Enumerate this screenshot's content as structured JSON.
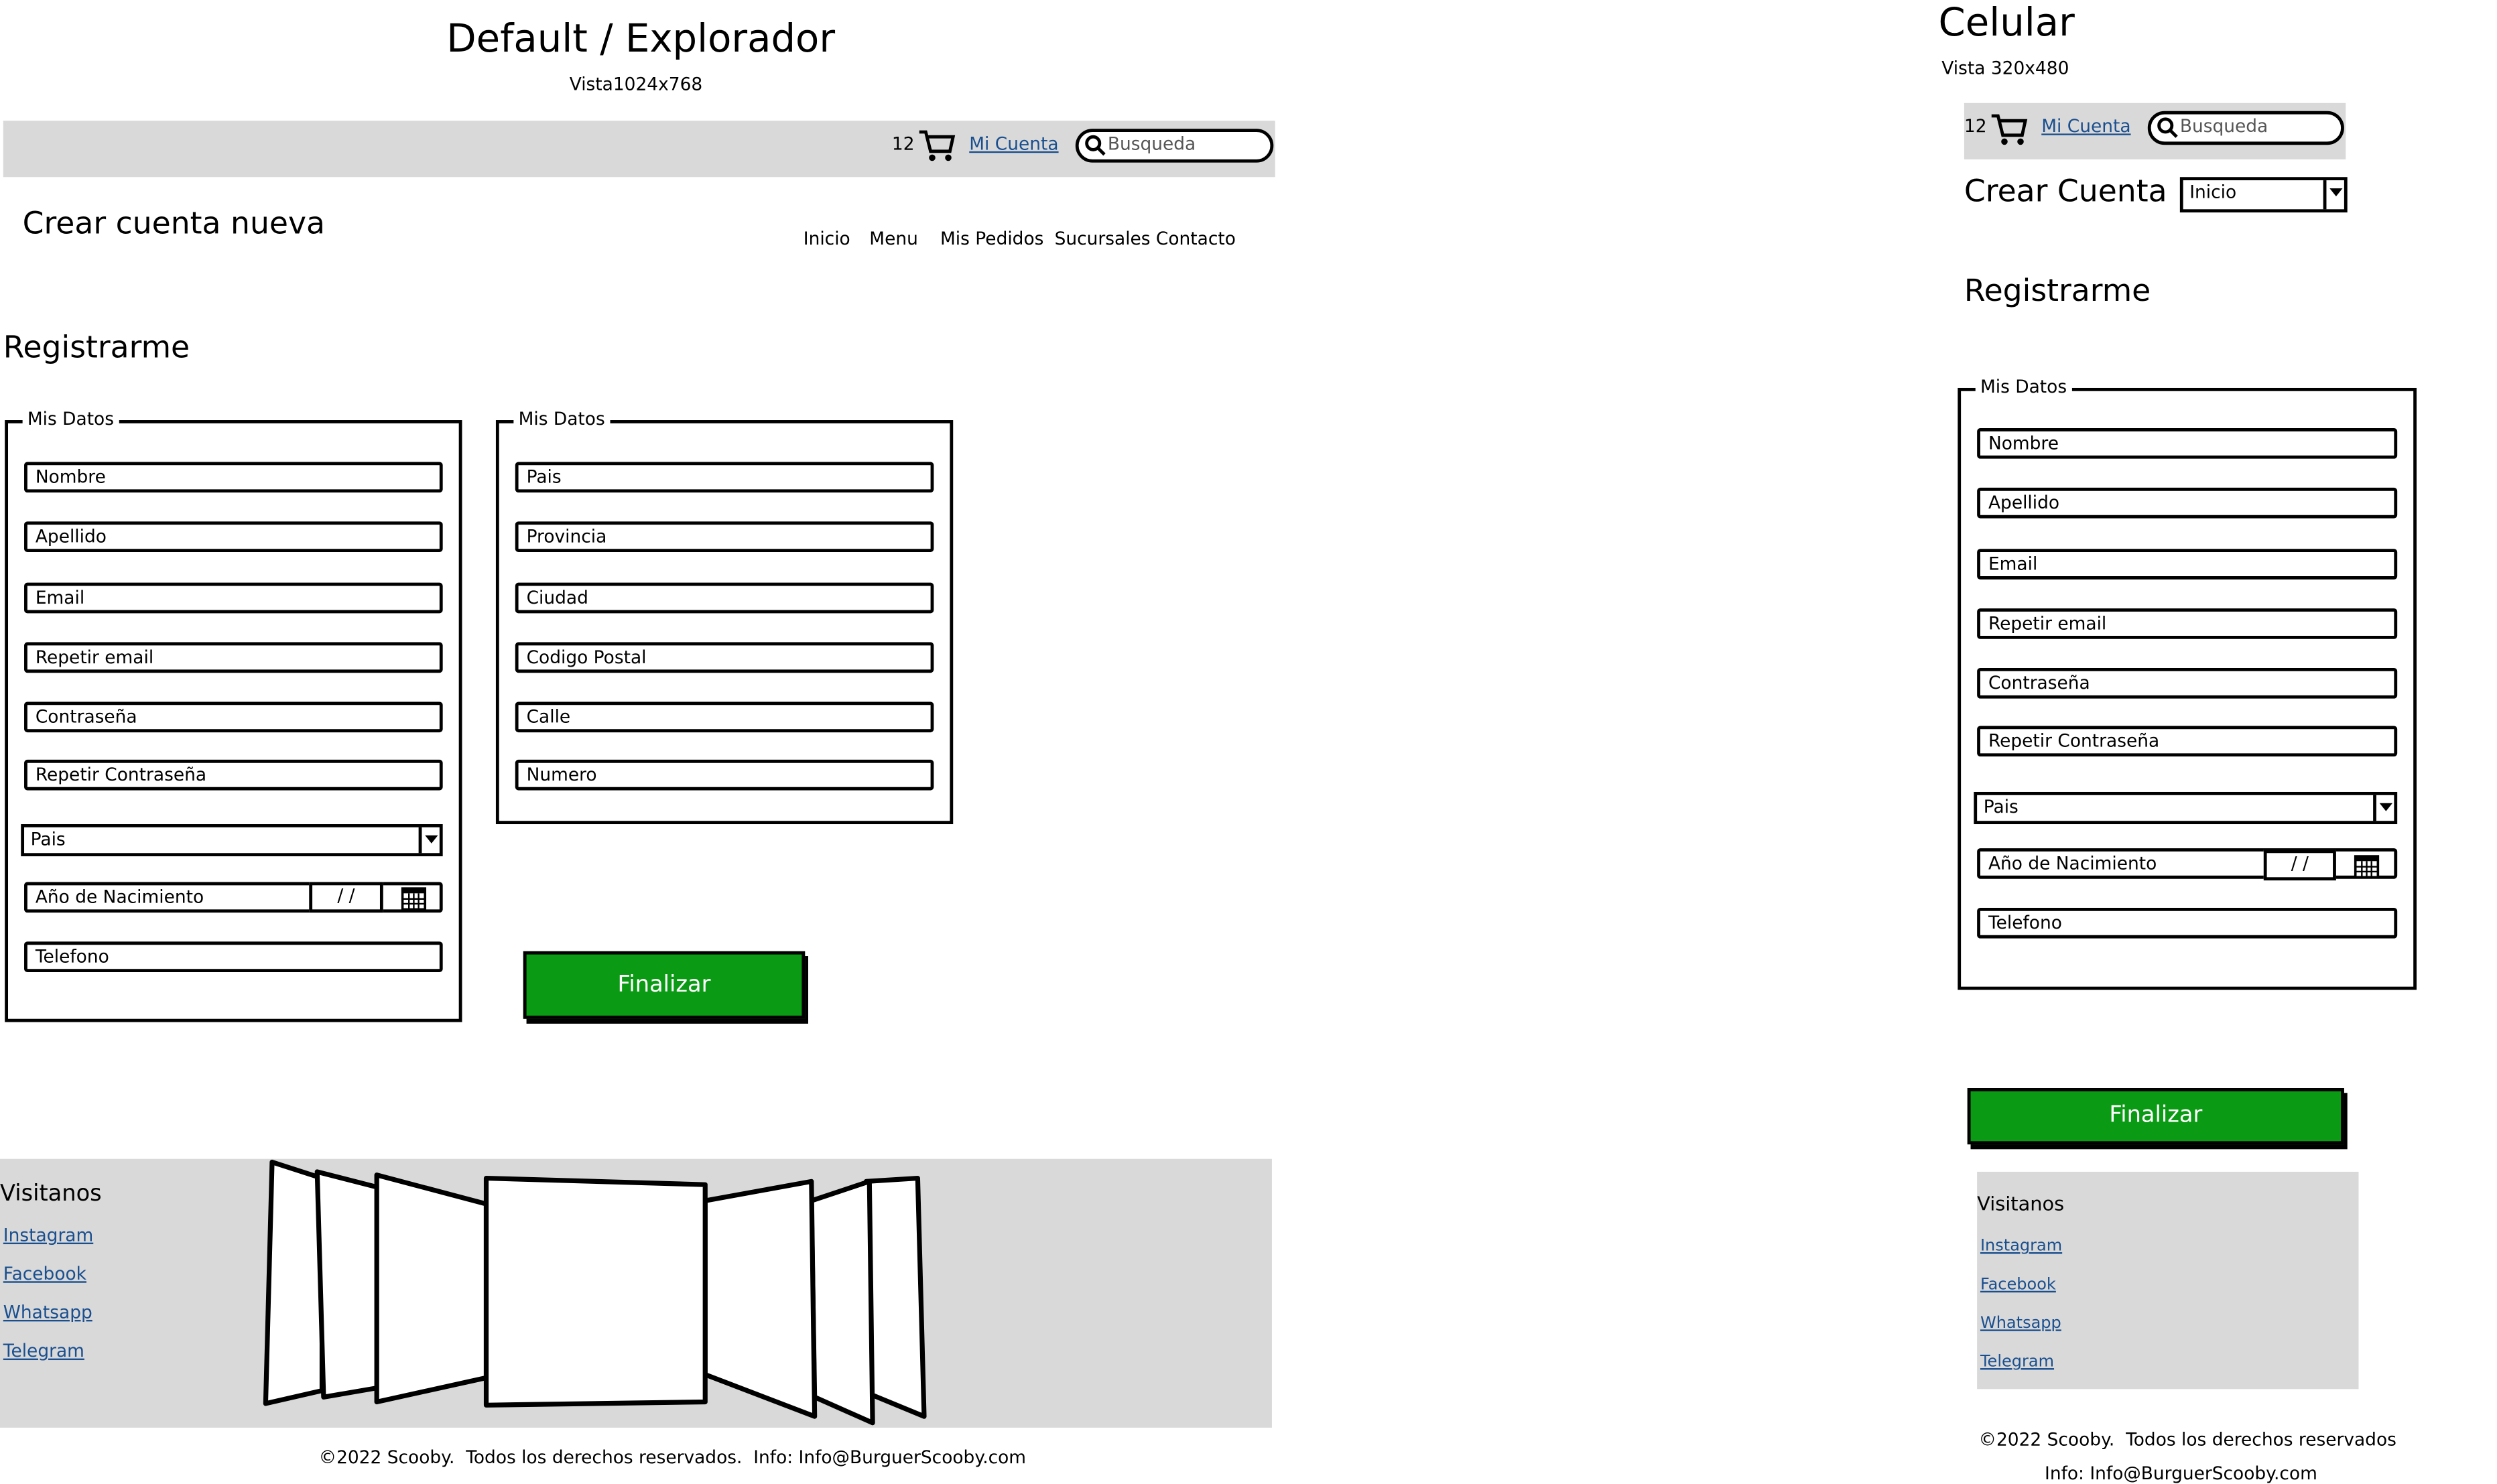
{
  "desktop": {
    "heading": "Default / Explorador",
    "subheading": "Vista1024x768",
    "topbar": {
      "cart_count": "12",
      "account_link": "Mi Cuenta",
      "search_placeholder": "Busqueda"
    },
    "page_title": "Crear cuenta nueva",
    "nav": [
      "Inicio",
      "Menu",
      "Mis Pedidos",
      "Sucursales",
      "Contacto"
    ],
    "section_title": "Registrarme",
    "group1": {
      "legend": "Mis Datos",
      "fields": [
        "Nombre",
        "Apellido",
        "Email",
        "Repetir email",
        "Contraseña",
        "Repetir Contraseña"
      ],
      "country_select": "Pais",
      "birth_label": "Año de Nacimiento",
      "date_value": "/ /",
      "phone": "Telefono"
    },
    "group2": {
      "legend": "Mis Datos",
      "fields": [
        "Pais",
        "Provincia",
        "Ciudad",
        "Codigo Postal",
        "Calle",
        "Numero"
      ]
    },
    "submit_label": "Finalizar",
    "footer": {
      "title": "Visitanos",
      "links": [
        "Instagram",
        "Facebook",
        "Whatsapp",
        "Telegram"
      ],
      "copyright": "©2022 Scooby.  Todos los derechos reservados.  Info: Info@BurguerScooby.com"
    }
  },
  "mobile": {
    "heading": "Celular",
    "subheading": "Vista 320x480",
    "topbar": {
      "cart_count": "12",
      "account_link": "Mi Cuenta",
      "search_placeholder": "Busqueda"
    },
    "page_title": "Crear Cuenta",
    "nav_select": "Inicio",
    "section_title": "Registrarme",
    "group": {
      "legend": "Mis Datos",
      "fields": [
        "Nombre",
        "Apellido",
        "Email",
        "Repetir email",
        "Contraseña",
        "Repetir Contraseña"
      ],
      "country_select": "Pais",
      "birth_label": "Año de Nacimiento",
      "date_value": "/ /",
      "phone": "Telefono"
    },
    "submit_label": "Finalizar",
    "footer": {
      "title": "Visitanos",
      "links": [
        "Instagram",
        "Facebook",
        "Whatsapp",
        "Telegram"
      ],
      "copyright_line1": "©2022 Scooby.  Todos los derechos reservados",
      "copyright_line2": "Info: Info@BurguerScooby.com"
    }
  },
  "colors": {
    "bar_gray": "#d9d9d9",
    "button_green": "#0a9a14",
    "link_blue": "#1a4f8f"
  }
}
